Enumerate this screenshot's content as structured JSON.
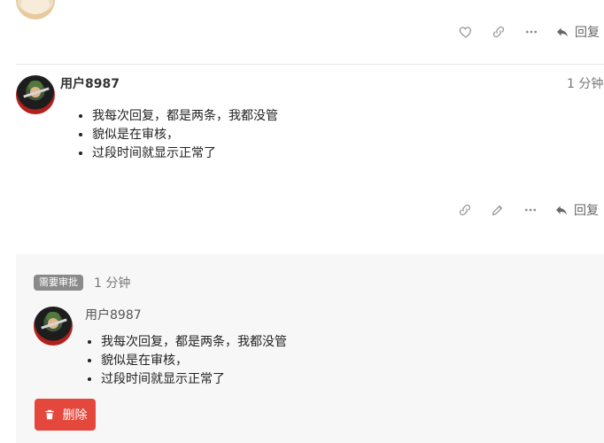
{
  "post1": {
    "actions": {
      "icons": [
        "heart-icon",
        "link-icon",
        "more-icon"
      ],
      "reply_label": "回复"
    }
  },
  "post2": {
    "username": "用户8987",
    "time": "1 分钟",
    "lines": [
      "我每次回复，都是两条，我都没管",
      "貌似是在审核，",
      "过段时间就显示正常了"
    ],
    "actions": {
      "icons": [
        "link-icon",
        "edit-icon",
        "more-icon"
      ],
      "reply_label": "回复"
    }
  },
  "review": {
    "badge": "需要审批",
    "time": "1 分钟",
    "username": "用户8987",
    "lines": [
      "我每次回复，都是两条，我都没管",
      "貌似是在审核，",
      "过段时间就显示正常了"
    ],
    "delete_label": "删除",
    "colors": {
      "panel_bg": "#f7f7f8",
      "badge_bg": "#8a8a8a",
      "danger": "#e4473b"
    }
  }
}
